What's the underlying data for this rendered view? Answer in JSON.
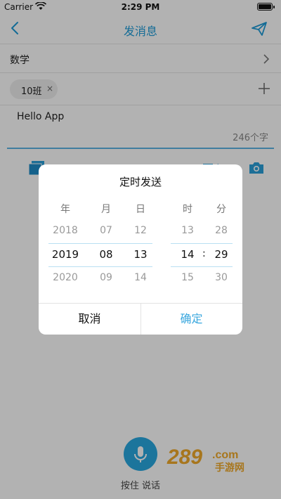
{
  "status_bar": {
    "carrier": "Carrier",
    "time": "2:29 PM"
  },
  "nav": {
    "title": "发消息",
    "icons": [
      "back-chevron",
      "send-paper-plane"
    ]
  },
  "subject": {
    "label": "数学"
  },
  "recipients": {
    "chip_label": "10班",
    "chip_remove": "×"
  },
  "message": {
    "text": "Hello App",
    "counter": "246个字"
  },
  "voice": {
    "label": "按住 说话"
  },
  "picker": {
    "title": "定时发送",
    "headers": {
      "year": "年",
      "month": "月",
      "day": "日",
      "hour": "时",
      "minute": "分"
    },
    "year": {
      "prev": "2018",
      "selected": "2019",
      "next": "2020"
    },
    "month": {
      "prev": "07",
      "selected": "08",
      "next": "09"
    },
    "day": {
      "prev": "12",
      "selected": "13",
      "next": "14"
    },
    "hour": {
      "prev": "13",
      "selected": "14",
      "next": "15"
    },
    "minute": {
      "prev": "28",
      "selected": "29",
      "next": "30"
    },
    "colon": ":",
    "cancel": "取消",
    "confirm": "确定"
  },
  "watermark": {
    "text": "289.com 手游网"
  },
  "colors": {
    "accent": "#1e9bd7",
    "underline": "#5cb4e4",
    "mic": "#29a8e0",
    "watermark": "#f0a92a"
  }
}
